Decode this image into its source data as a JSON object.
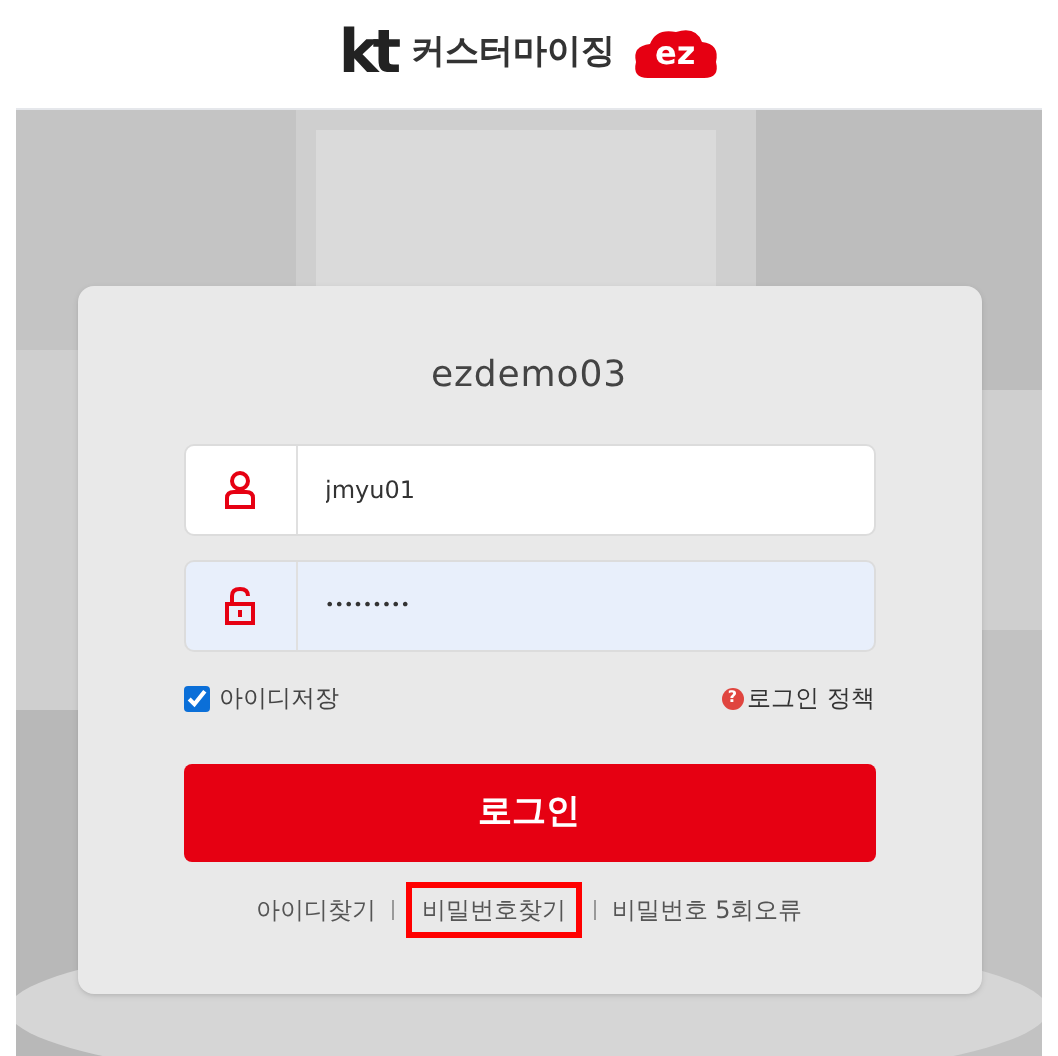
{
  "header": {
    "logo_mark": "kt",
    "service_name": "커스터마이징",
    "badge": "ez"
  },
  "login": {
    "title": "ezdemo03",
    "fields": [
      {
        "kind": "user",
        "value": "jmyu01",
        "focused": false
      },
      {
        "kind": "password",
        "value": "•••••••••",
        "focused": true
      }
    ],
    "remember_id": {
      "label": "아이디저장",
      "checked": true
    },
    "policy_link": {
      "icon": "?",
      "label": "로그인 정책"
    },
    "submit": "로그인",
    "links": [
      {
        "label": "아이디찾기",
        "highlighted": false
      },
      {
        "label": "비밀번호찾기",
        "highlighted": true
      },
      {
        "label": "비밀번호 5회오류",
        "highlighted": false
      }
    ]
  }
}
